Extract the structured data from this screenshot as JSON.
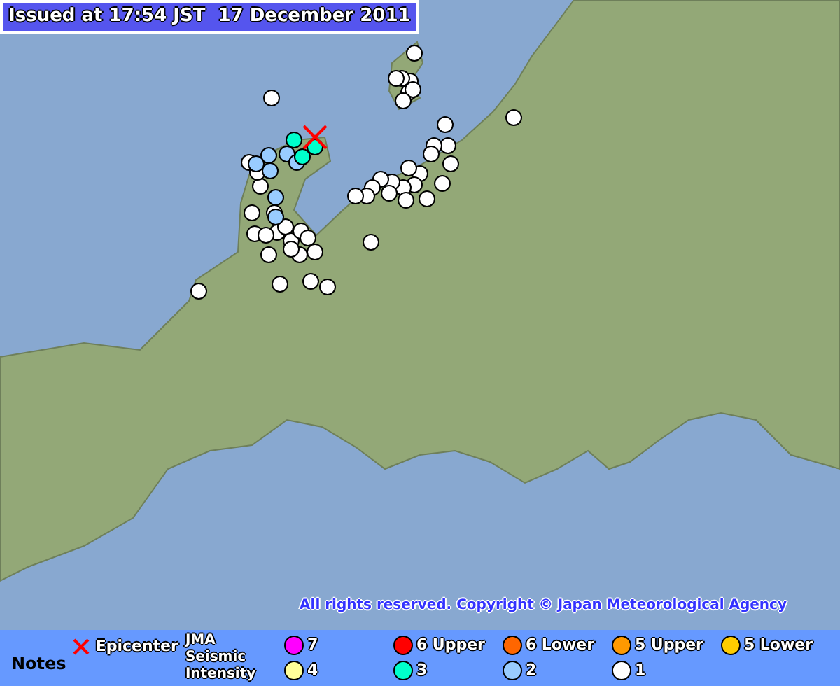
{
  "issued": "Issued at 17:54 JST  17 December 2011",
  "copyright": "All rights reserved. Copyright © Japan Meteorological Agency",
  "legend": {
    "notes_label": "Notes",
    "epicenter_label": "Epicenter",
    "intensity_title": "JMA Seismic Intensity",
    "levels": [
      {
        "label": "7",
        "color": "#ff00ff"
      },
      {
        "label": "6 Upper",
        "color": "#ff0000"
      },
      {
        "label": "6 Lower",
        "color": "#ff6600"
      },
      {
        "label": "5 Upper",
        "color": "#ff9900"
      },
      {
        "label": "5 Lower",
        "color": "#ffcc00"
      },
      {
        "label": "4",
        "color": "#ffff99"
      },
      {
        "label": "3",
        "color": "#00ffcc"
      },
      {
        "label": "2",
        "color": "#99ccff"
      },
      {
        "label": "1",
        "color": "#ffffff"
      }
    ]
  }
}
